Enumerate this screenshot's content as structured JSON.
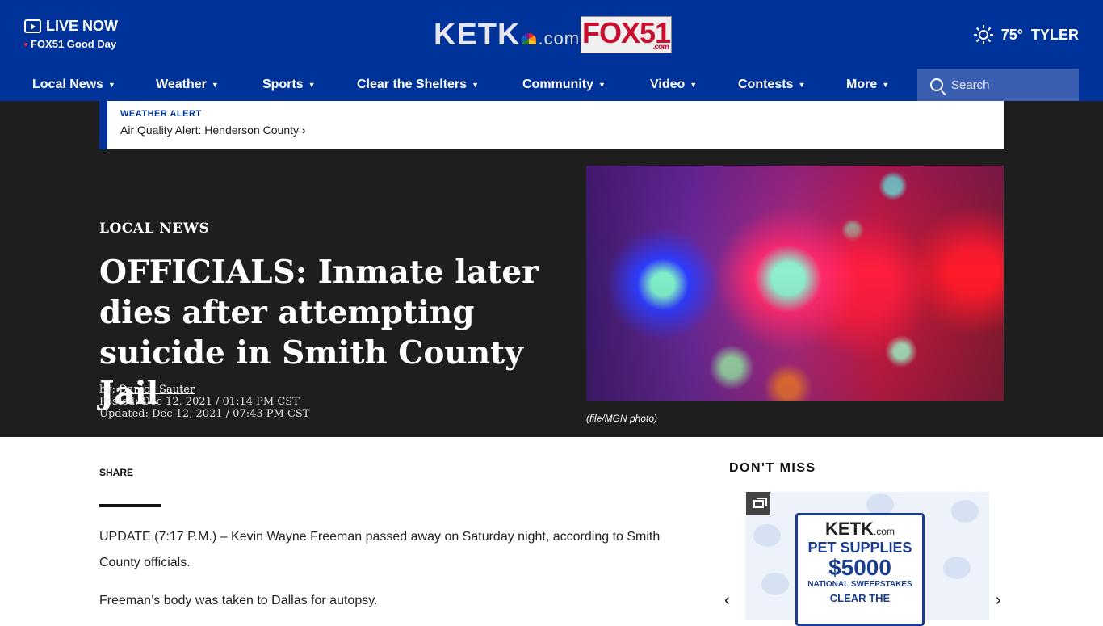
{
  "header": {
    "live_label": "LIVE NOW",
    "live_show": "FOX51 Good Day",
    "ketk_logo": "KETK",
    "ketk_com": ".com",
    "fox_logo": "FOX51",
    "fox_com": ".com",
    "temperature": "75°",
    "city": "TYLER"
  },
  "nav": {
    "items": [
      "Local News",
      "Weather",
      "Sports",
      "Clear the Shelters",
      "Community",
      "Video",
      "Contests",
      "More"
    ],
    "search_placeholder": "Search"
  },
  "alert": {
    "label": "WEATHER ALERT",
    "text": "Air Quality Alert: Henderson County"
  },
  "article": {
    "section": "LOCAL NEWS",
    "headline": "OFFICIALS: Inmate later dies after attempting suicide in Smith County Jail",
    "by_prefix": "by:",
    "author": "Danica Sauter",
    "posted": "Posted: Dec 12, 2021 / 01:14 PM CST",
    "updated": "Updated: Dec 12, 2021 / 07:43 PM CST",
    "photo_caption": "(file/MGN photo)",
    "share_label": "SHARE",
    "paragraphs": [
      "UPDATE (7:17 P.M.) – Kevin Wayne Freeman passed away on Saturday night, according to Smith County officials.",
      "Freeman’s body was taken to Dallas for autopsy."
    ]
  },
  "sidebar": {
    "title": "DON'T MISS",
    "promo": {
      "brand": "KETK",
      "brand_com": ".com",
      "line1": "PET SUPPLIES",
      "amount": "$5000",
      "line2": "NATIONAL SWEEPSTAKES",
      "line3": "CLEAR THE"
    }
  },
  "colors": {
    "brand_blue": "#003399",
    "hero_bg": "#1e1e1e",
    "fox_red": "#c8102e"
  }
}
